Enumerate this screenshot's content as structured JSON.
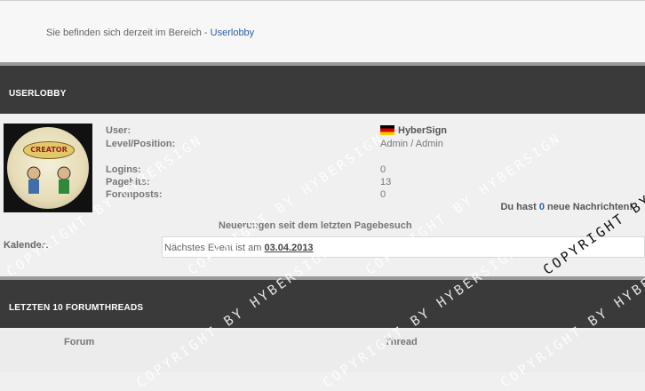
{
  "breadcrumb": {
    "prefix": "Sie befinden sich derzeit im Bereich - ",
    "link": "Userlobby"
  },
  "userlobby": {
    "title": "USERLOBBY",
    "avatar_text": "CREATOR",
    "labels": {
      "user": "User:",
      "level": "Level/Position:",
      "logins": "Logins:",
      "pagehits": "Pagehits:",
      "forenposts": "Forenposts:"
    },
    "values": {
      "user": "HyberSign",
      "level": "Admin / Admin",
      "logins": "0",
      "pagehits": "13",
      "forenposts": "0"
    },
    "messages": {
      "prefix": "Du hast ",
      "count": "0",
      "suffix": " neue Nachrichten!"
    },
    "news": "Neuerungen seit dem letzten Pagebesuch",
    "calendar_label": "Kalender:",
    "event_text": "Nächstes Event ist am ",
    "event_date": "03.04.2013"
  },
  "threads": {
    "title": "LETZTEN 10 FORUMTHREADS",
    "columns": {
      "forum": "Forum",
      "thread": "Thread"
    }
  },
  "watermark": "COPYRIGHT BY HYBERSIGN",
  "colors": {
    "header_bg": "#3a3a3a",
    "link": "#2b5ea8",
    "page_bg": "#f0f0f0"
  }
}
